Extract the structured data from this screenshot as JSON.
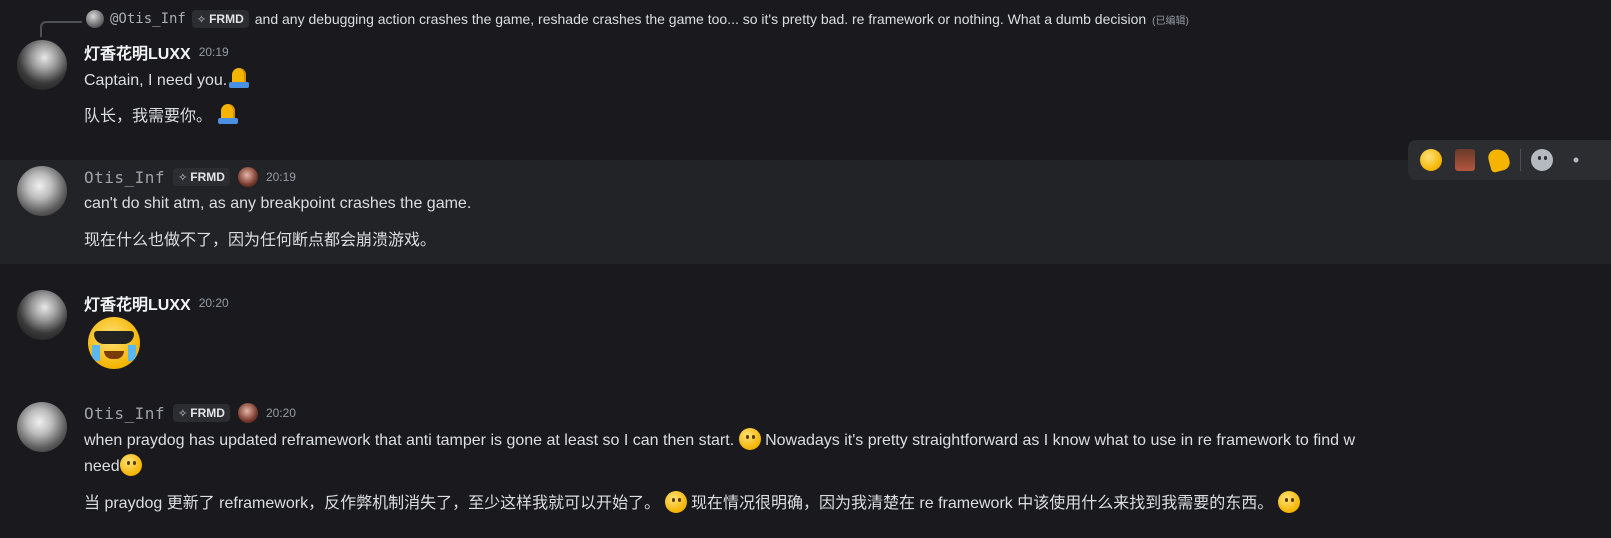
{
  "reply": {
    "username": "@Otis_Inf",
    "tag": "FRMD",
    "text": "and any debugging action crashes the game, reshade crashes the game too... so it's pretty bad. re framework or nothing. What a dumb decision",
    "edited": "(已编辑)"
  },
  "messages": [
    {
      "username": "灯香花明LUXX",
      "time": "20:19",
      "lines": [
        "Captain, I need you.",
        "队长，我需要你。"
      ]
    },
    {
      "username": "Otis_Inf",
      "tag": "FRMD",
      "time": "20:19",
      "lines": [
        "can't do shit atm, as any breakpoint crashes the game.",
        "现在什么也做不了，因为任何断点都会崩溃游戏。"
      ]
    },
    {
      "username": "灯香花明LUXX",
      "time": "20:20",
      "emoji": "crying-sunglasses-emoji"
    },
    {
      "username": "Otis_Inf",
      "tag": "FRMD",
      "time": "20:20",
      "line1a": "when praydog has updated reframework that anti tamper is gone at least so I can then start.",
      "line1b": "Nowadays it's pretty straightforward as I know what to use in re framework to find w",
      "line2": "need",
      "line3a": "当 praydog 更新了 reframework，反作弊机制消失了，至少这样我就可以开始了。",
      "line3b": "现在情况很明确，因为我清楚在 re framework 中该使用什么来找到我需要的东西。"
    }
  ],
  "reaction_bar": {
    "items": [
      "nerd-face-emoji",
      "character-sticker",
      "waving-hand-emoji",
      "add-reaction-icon",
      "more-icon"
    ],
    "more_glyph": "•"
  }
}
